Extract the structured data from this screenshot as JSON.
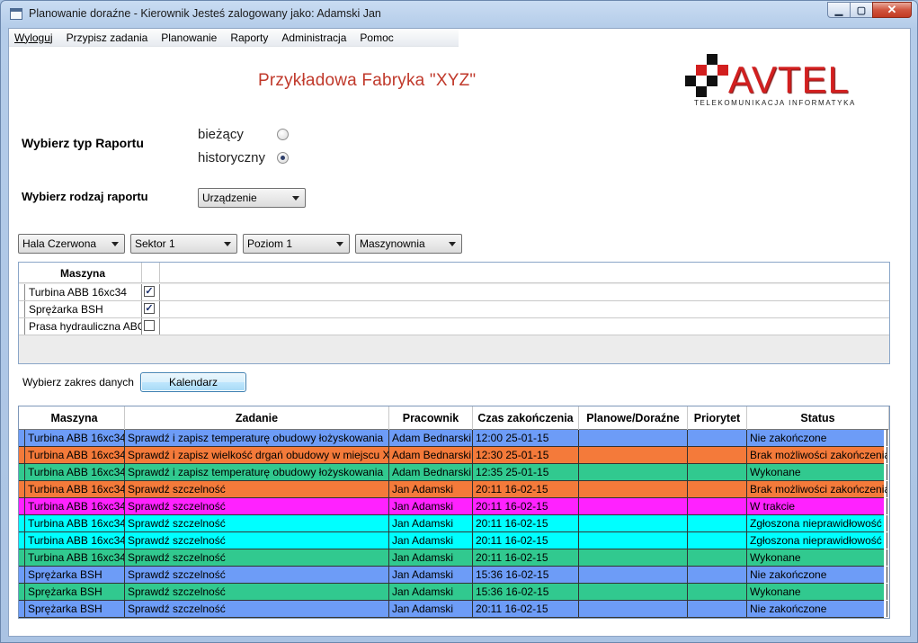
{
  "window": {
    "title": "Planowanie doraźne - Kierownik Jesteś zalogowany jako: Adamski Jan",
    "buttons": {
      "minimize": "▁",
      "maximize": "▢",
      "close": "✕"
    }
  },
  "menu": [
    {
      "label": "Wyloguj"
    },
    {
      "label": "Przypisz zadania"
    },
    {
      "label": "Planowanie"
    },
    {
      "label": "Raporty"
    },
    {
      "label": "Administracja"
    },
    {
      "label": "Pomoc"
    }
  ],
  "header": {
    "factory_title": "Przykładowa Fabryka \"XYZ\"",
    "logo_word": "AVTEL",
    "logo_tagline": "TELEKOMUNIKACJA INFORMATYKA",
    "brand_color": "#d21f1f"
  },
  "report_type": {
    "label": "Wybierz typ Raportu",
    "options": [
      {
        "label": "bieżący",
        "selected": false
      },
      {
        "label": "historyczny",
        "selected": true
      }
    ]
  },
  "report_kind": {
    "label": "Wybierz rodzaj raportu",
    "selected": "Urządzenie"
  },
  "filters": [
    {
      "name": "hall",
      "selected": "Hala Czerwona"
    },
    {
      "name": "sector",
      "selected": "Sektor 1"
    },
    {
      "name": "level",
      "selected": "Poziom 1"
    },
    {
      "name": "room",
      "selected": "Maszynownia"
    }
  ],
  "machine_list": {
    "header": "Maszyna",
    "rows": [
      {
        "name": "Turbina ABB 16xc34",
        "checked": true
      },
      {
        "name": "Sprężarka BSH",
        "checked": true
      },
      {
        "name": "Prasa hydrauliczna ABC",
        "checked": false
      }
    ]
  },
  "date_range": {
    "label": "Wybierz zakres danych",
    "button": "Kalendarz"
  },
  "tasks_table": {
    "columns": [
      "Maszyna",
      "Zadanie",
      "Pracownik",
      "Czas zakończenia",
      "Planowe/Doraźne",
      "Priorytet",
      "Status"
    ],
    "status_colors": {
      "Nie zakończone": "#6d9cf7",
      "Brak możliwości zakończenia": "#f47a3a",
      "Wykonane": "#31c98f",
      "W trakcie": "#ff22ff",
      "Zgłoszona nieprawidłowość": "#00ffff"
    },
    "rows": [
      [
        "Turbina ABB 16xc34",
        "Sprawdź i zapisz temperaturę obudowy łożyskowania",
        "Adam Bednarski",
        "12:00 25-01-15",
        "",
        "",
        "Nie zakończone"
      ],
      [
        "Turbina ABB 16xc34",
        "Sprawdź i zapisz wielkość drgań obudowy w miejscu X",
        "Adam Bednarski",
        "12:30 25-01-15",
        "",
        "",
        "Brak możliwości zakończenia"
      ],
      [
        "Turbina ABB 16xc34",
        "Sprawdź i zapisz temperaturę obudowy łożyskowania",
        "Adam Bednarski",
        "12:35 25-01-15",
        "",
        "",
        "Wykonane"
      ],
      [
        "Turbina ABB 16xc34",
        "Sprawdź szczelność",
        "Jan Adamski",
        "20:11 16-02-15",
        "",
        "",
        "Brak możliwości zakończenia"
      ],
      [
        "Turbina ABB 16xc34",
        "Sprawdź szczelność",
        "Jan Adamski",
        "20:11 16-02-15",
        "",
        "",
        "W trakcie"
      ],
      [
        "Turbina ABB 16xc34",
        "Sprawdź szczelność",
        "Jan Adamski",
        "20:11 16-02-15",
        "",
        "",
        "Zgłoszona nieprawidłowość"
      ],
      [
        "Turbina ABB 16xc34",
        "Sprawdź szczelność",
        "Jan Adamski",
        "20:11 16-02-15",
        "",
        "",
        "Zgłoszona nieprawidłowość"
      ],
      [
        "Turbina ABB 16xc34",
        "Sprawdź szczelność",
        "Jan Adamski",
        "20:11 16-02-15",
        "",
        "",
        "Wykonane"
      ],
      [
        "Sprężarka BSH",
        "Sprawdź szczelność",
        "Jan Adamski",
        "15:36 16-02-15",
        "",
        "",
        "Nie zakończone"
      ],
      [
        "Sprężarka BSH",
        "Sprawdź szczelność",
        "Jan Adamski",
        "15:36 16-02-15",
        "",
        "",
        "Wykonane"
      ],
      [
        "Sprężarka BSH",
        "Sprawdź szczelność",
        "Jan Adamski",
        "20:11 16-02-15",
        "",
        "",
        "Nie zakończone"
      ]
    ]
  }
}
